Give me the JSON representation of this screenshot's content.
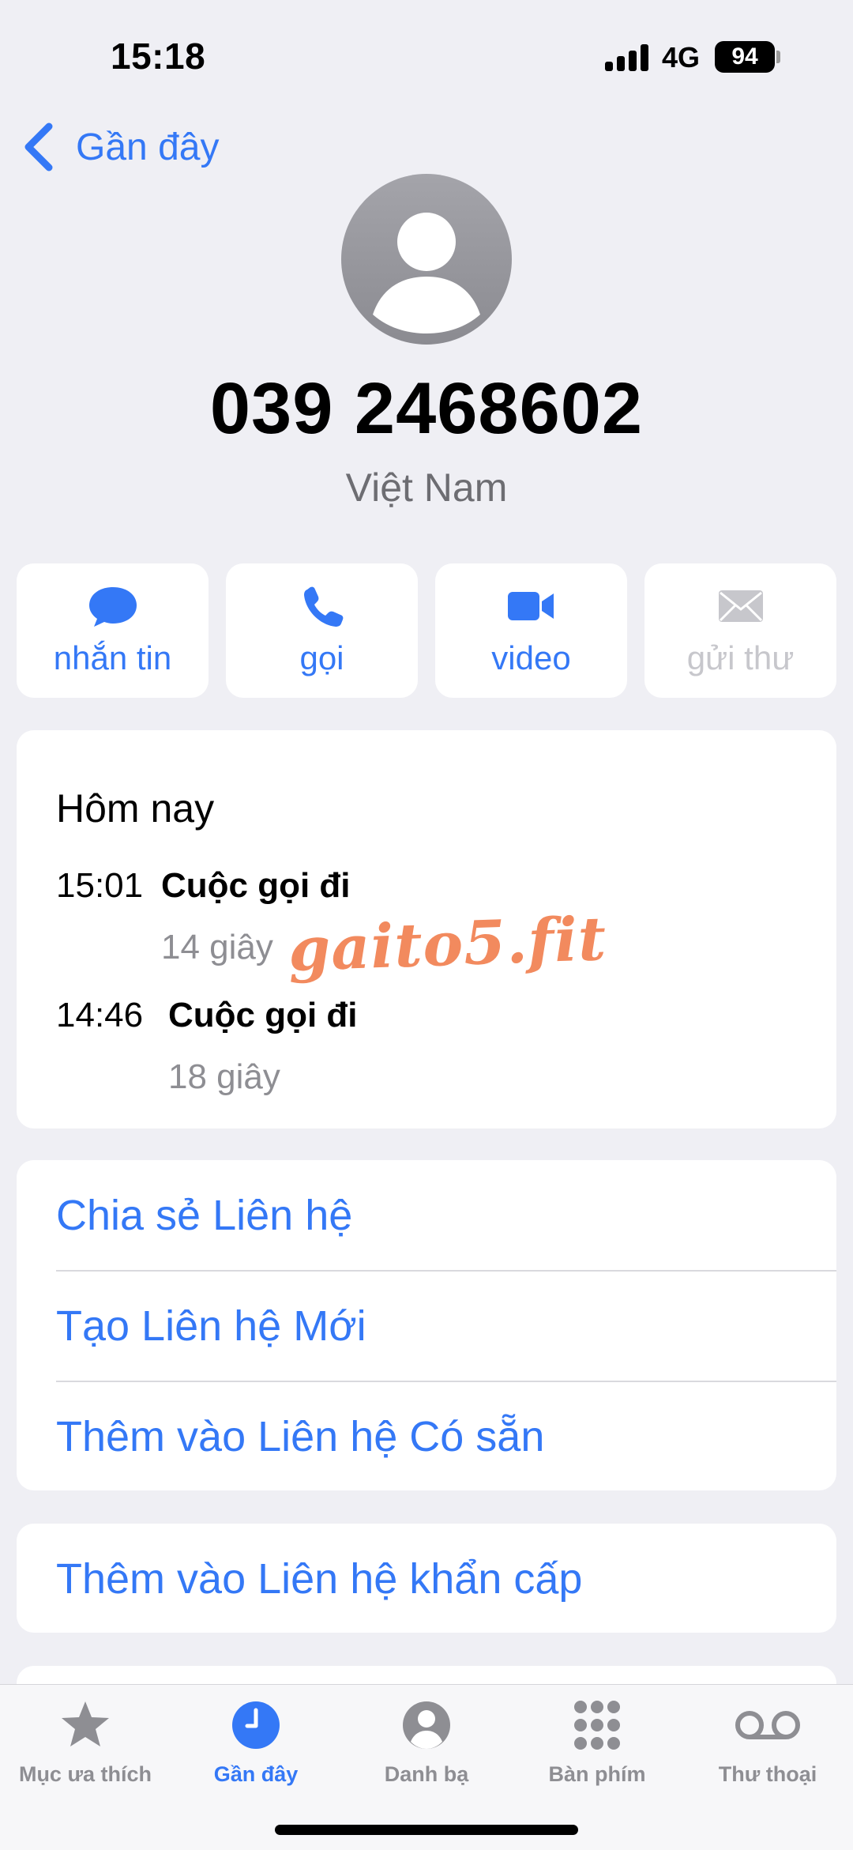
{
  "status_bar": {
    "time": "15:18",
    "network": "4G",
    "battery": "94"
  },
  "nav": {
    "back_label": "Gần đây",
    "back_icon": "chevron-left-icon"
  },
  "contact": {
    "avatar_icon": "person-icon",
    "phone_number": "039 2468602",
    "country": "Việt Nam"
  },
  "actions": [
    {
      "label": "nhắn tin",
      "icon": "message-bubble-icon",
      "enabled": true
    },
    {
      "label": "gọi",
      "icon": "phone-icon",
      "enabled": true
    },
    {
      "label": "video",
      "icon": "video-camera-icon",
      "enabled": true
    },
    {
      "label": "gửi thư",
      "icon": "envelope-icon",
      "enabled": false
    }
  ],
  "history": {
    "title": "Hôm nay",
    "calls": [
      {
        "time": "15:01",
        "type": "Cuộc gọi đi",
        "duration": "14 giây"
      },
      {
        "time": "14:46",
        "type": "Cuộc gọi đi",
        "duration": "18 giây"
      }
    ]
  },
  "watermark": "gaito5.fit",
  "contact_options": [
    "Chia sẻ Liên hệ",
    "Tạo Liên hệ Mới",
    "Thêm vào Liên hệ Có sẵn"
  ],
  "emergency_option": "Thêm vào Liên hệ khẩn cấp",
  "tabbar": {
    "active": "Gần đây",
    "tabs": [
      {
        "label": "Mục ưa thích",
        "icon": "star-icon"
      },
      {
        "label": "Gần đây",
        "icon": "clock-icon"
      },
      {
        "label": "Danh bạ",
        "icon": "person-circle-icon"
      },
      {
        "label": "Bàn phím",
        "icon": "keypad-icon"
      },
      {
        "label": "Thư thoại",
        "icon": "voicemail-icon"
      }
    ]
  },
  "colors": {
    "accent": "#3478f6",
    "disabled": "#c7c7cc",
    "secondary_text": "#8e8e93",
    "background": "#efeff4",
    "watermark": "#f28a5e"
  }
}
